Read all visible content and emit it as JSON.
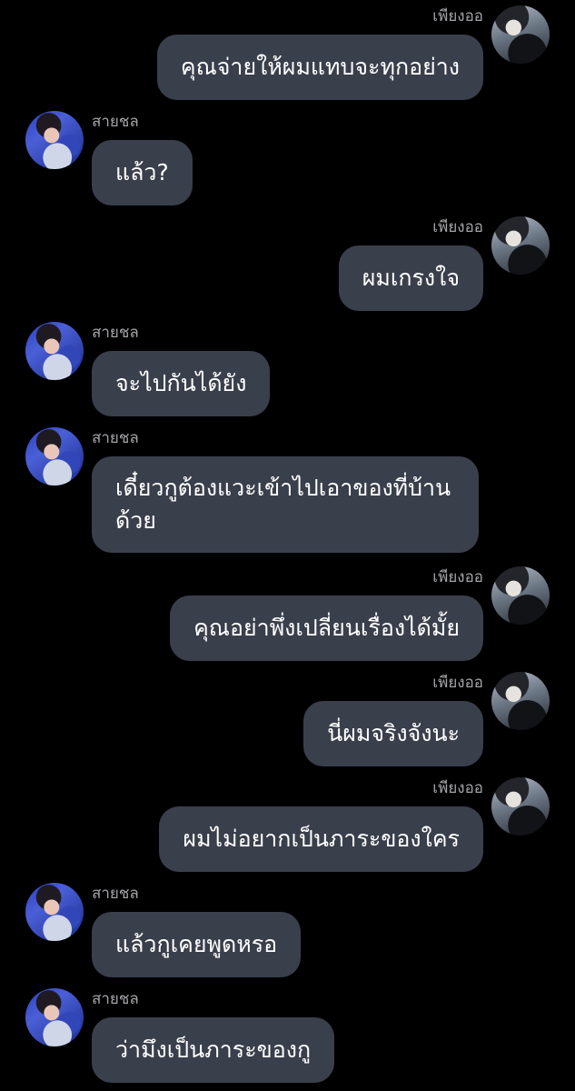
{
  "messages": [
    {
      "side": "right",
      "name": "เพียงออ",
      "text": "คุณจ่ายให้ผมแทบจะทุกอย่าง"
    },
    {
      "side": "left",
      "name": "สายชล",
      "text": "แล้ว?"
    },
    {
      "side": "right",
      "name": "เพียงออ",
      "text": "ผมเกรงใจ"
    },
    {
      "side": "left",
      "name": "สายชล",
      "text": "จะไปกันได้ยัง"
    },
    {
      "side": "left",
      "name": "สายชล",
      "text": "เดี๋ยวกูต้องแวะเข้าไปเอาของที่บ้านด้วย"
    },
    {
      "side": "right",
      "name": "เพียงออ",
      "text": "คุณอย่าพึ่งเปลี่ยนเรื่องได้มั้ย"
    },
    {
      "side": "right",
      "name": "เพียงออ",
      "text": "นี่ผมจริงจังนะ"
    },
    {
      "side": "right",
      "name": "เพียงออ",
      "text": "ผมไม่อยากเป็นภาระของใคร"
    },
    {
      "side": "left",
      "name": "สายชล",
      "text": "แล้วกูเคยพูดหรอ"
    },
    {
      "side": "left",
      "name": "สายชล",
      "text": "ว่ามึงเป็นภาระของกู"
    }
  ]
}
